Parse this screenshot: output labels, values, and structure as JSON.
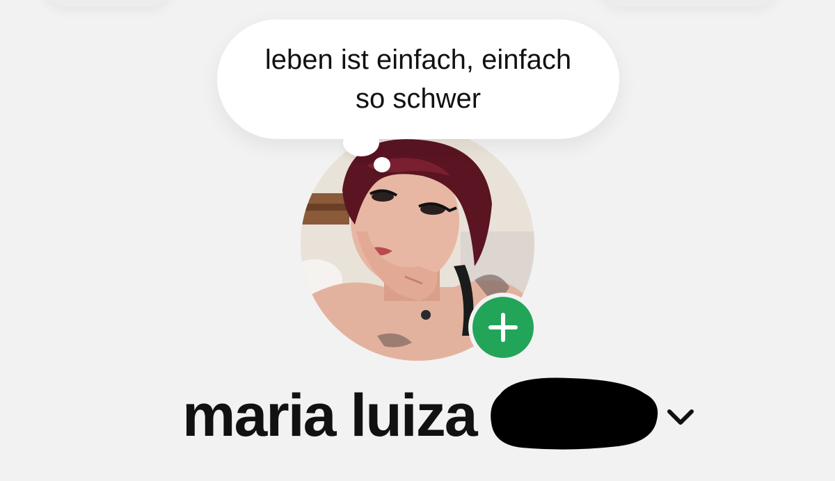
{
  "note": {
    "text": "leben ist einfach, einfach\nso schwer"
  },
  "profile": {
    "name": "maria luiza",
    "name_redacted": true,
    "avatar_description": "profile-photo"
  },
  "icons": {
    "add_story": "plus-icon",
    "account_switcher": "chevron-down-icon"
  },
  "colors": {
    "background": "#f2f2f2",
    "bubble": "#ffffff",
    "accent_green": "#22a559",
    "text": "#111111",
    "redaction": "#000000"
  }
}
